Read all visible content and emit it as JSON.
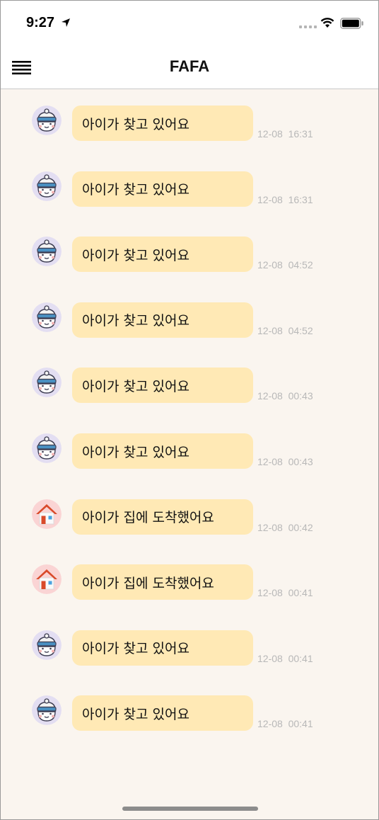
{
  "status_bar": {
    "time": "9:27",
    "icons": [
      "location-arrow-icon",
      "signal-icon",
      "wifi-icon",
      "battery-icon"
    ]
  },
  "nav": {
    "title": "FAFA",
    "menu_icon": "hamburger-menu-icon"
  },
  "colors": {
    "bubble": "#ffe9b5",
    "background": "#faf5ef",
    "timestamp": "#b8b8b8"
  },
  "messages": [
    {
      "avatar": "child-hat-icon",
      "text": "아이가 찾고 있어요",
      "time": "12-08  16:31"
    },
    {
      "avatar": "child-hat-icon",
      "text": "아이가 찾고 있어요",
      "time": "12-08  16:31"
    },
    {
      "avatar": "child-hat-icon",
      "text": "아이가 찾고 있어요",
      "time": "12-08  04:52"
    },
    {
      "avatar": "child-hat-icon",
      "text": "아이가 찾고 있어요",
      "time": "12-08  04:52"
    },
    {
      "avatar": "child-hat-icon",
      "text": "아이가 찾고 있어요",
      "time": "12-08  00:43"
    },
    {
      "avatar": "child-hat-icon",
      "text": "아이가 찾고 있어요",
      "time": "12-08  00:43"
    },
    {
      "avatar": "home-icon",
      "text": "아이가 집에 도착했어요",
      "time": "12-08  00:42"
    },
    {
      "avatar": "home-icon",
      "text": "아이가 집에 도착했어요",
      "time": "12-08  00:41"
    },
    {
      "avatar": "child-hat-icon",
      "text": "아이가 찾고 있어요",
      "time": "12-08  00:41"
    },
    {
      "avatar": "child-hat-icon",
      "text": "아이가 찾고 있어요",
      "time": "12-08  00:41"
    }
  ]
}
